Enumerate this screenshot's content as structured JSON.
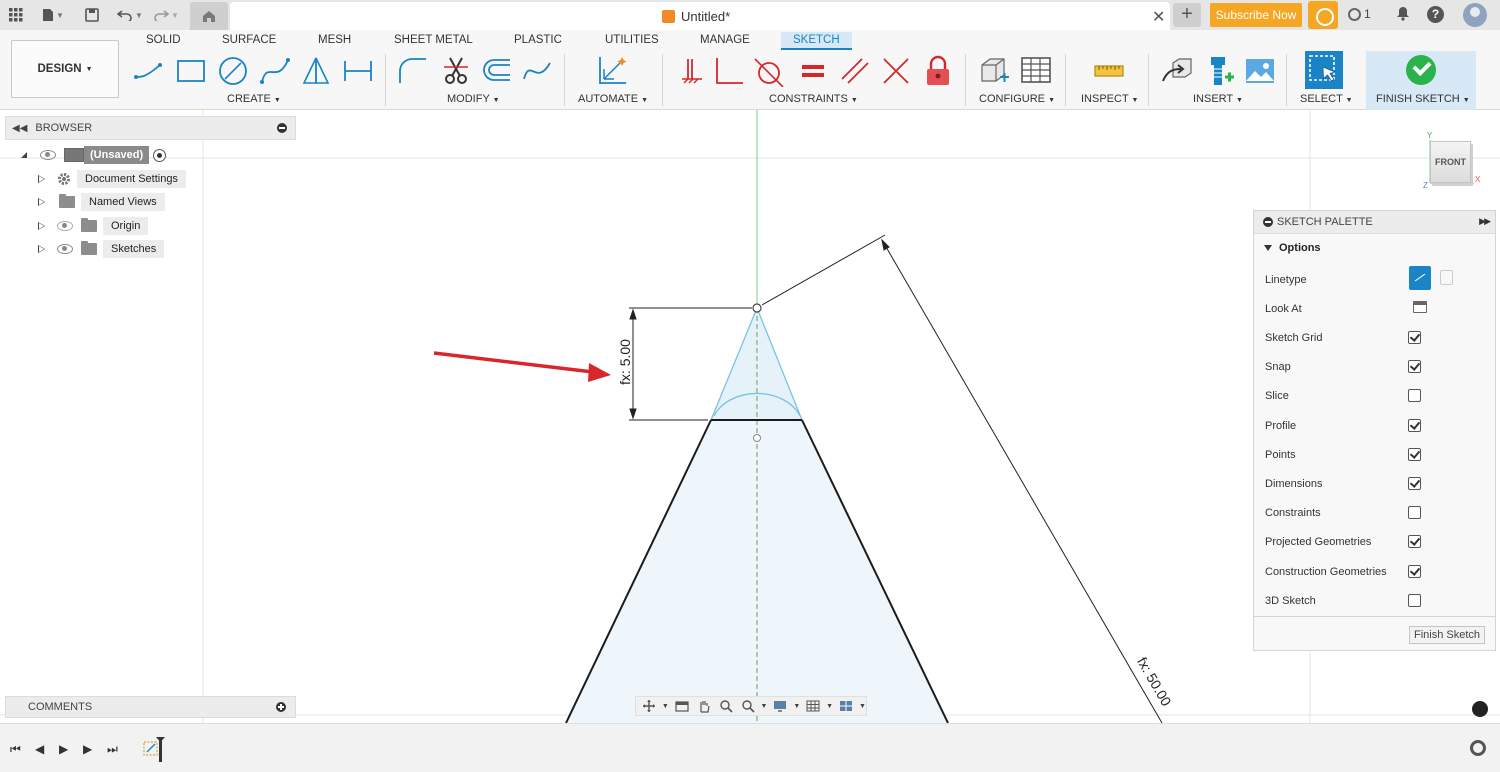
{
  "window": {
    "doc_title": "Untitled*",
    "subscribe_label": "Subscribe Now",
    "job_count": "1",
    "help_label": "?"
  },
  "ribbon": {
    "workspace_label": "DESIGN",
    "tabs": [
      "SOLID",
      "SURFACE",
      "MESH",
      "SHEET METAL",
      "PLASTIC",
      "UTILITIES",
      "MANAGE",
      "SKETCH"
    ],
    "active_tab": "SKETCH",
    "groups": {
      "create": "CREATE",
      "modify": "MODIFY",
      "automate": "AUTOMATE",
      "constraints": "CONSTRAINTS",
      "configure": "CONFIGURE",
      "inspect": "INSPECT",
      "insert": "INSERT",
      "select": "SELECT",
      "finish": "FINISH SKETCH"
    }
  },
  "browser": {
    "title": "BROWSER",
    "root_label": "(Unsaved)",
    "items": [
      {
        "label": "Document Settings",
        "icon": "gear-icon"
      },
      {
        "label": "Named Views",
        "icon": "folder-icon"
      },
      {
        "label": "Origin",
        "icon": "folder-icon"
      },
      {
        "label": "Sketches",
        "icon": "folder-icon"
      }
    ]
  },
  "canvas": {
    "dimension_small": "fx: 5.00",
    "dimension_large": "fx: 50.00",
    "view_cube_label": "FRONT",
    "axis_labels": {
      "y": "Y",
      "z": "Z",
      "x": "X"
    }
  },
  "sketch_palette": {
    "title": "SKETCH PALETTE",
    "section": "Options",
    "rows": [
      {
        "label": "Linetype",
        "control": "linetype"
      },
      {
        "label": "Look At",
        "control": "lookat"
      },
      {
        "label": "Sketch Grid",
        "checked": true
      },
      {
        "label": "Snap",
        "checked": true
      },
      {
        "label": "Slice",
        "checked": false
      },
      {
        "label": "Profile",
        "checked": true
      },
      {
        "label": "Points",
        "checked": true
      },
      {
        "label": "Dimensions",
        "checked": true
      },
      {
        "label": "Constraints",
        "checked": false
      },
      {
        "label": "Projected Geometries",
        "checked": true
      },
      {
        "label": "Construction Geometries",
        "checked": true
      },
      {
        "label": "3D Sketch",
        "checked": false
      }
    ],
    "finish_button": "Finish Sketch"
  },
  "comments": {
    "title": "COMMENTS"
  },
  "colors": {
    "accent": "#1a84c7",
    "subscribe": "#f5a623",
    "finish_green": "#2bb34b",
    "annotation_arrow": "#d9262b",
    "sketch_fill": "#eef6fb",
    "construction_line": "#79c3e0"
  }
}
